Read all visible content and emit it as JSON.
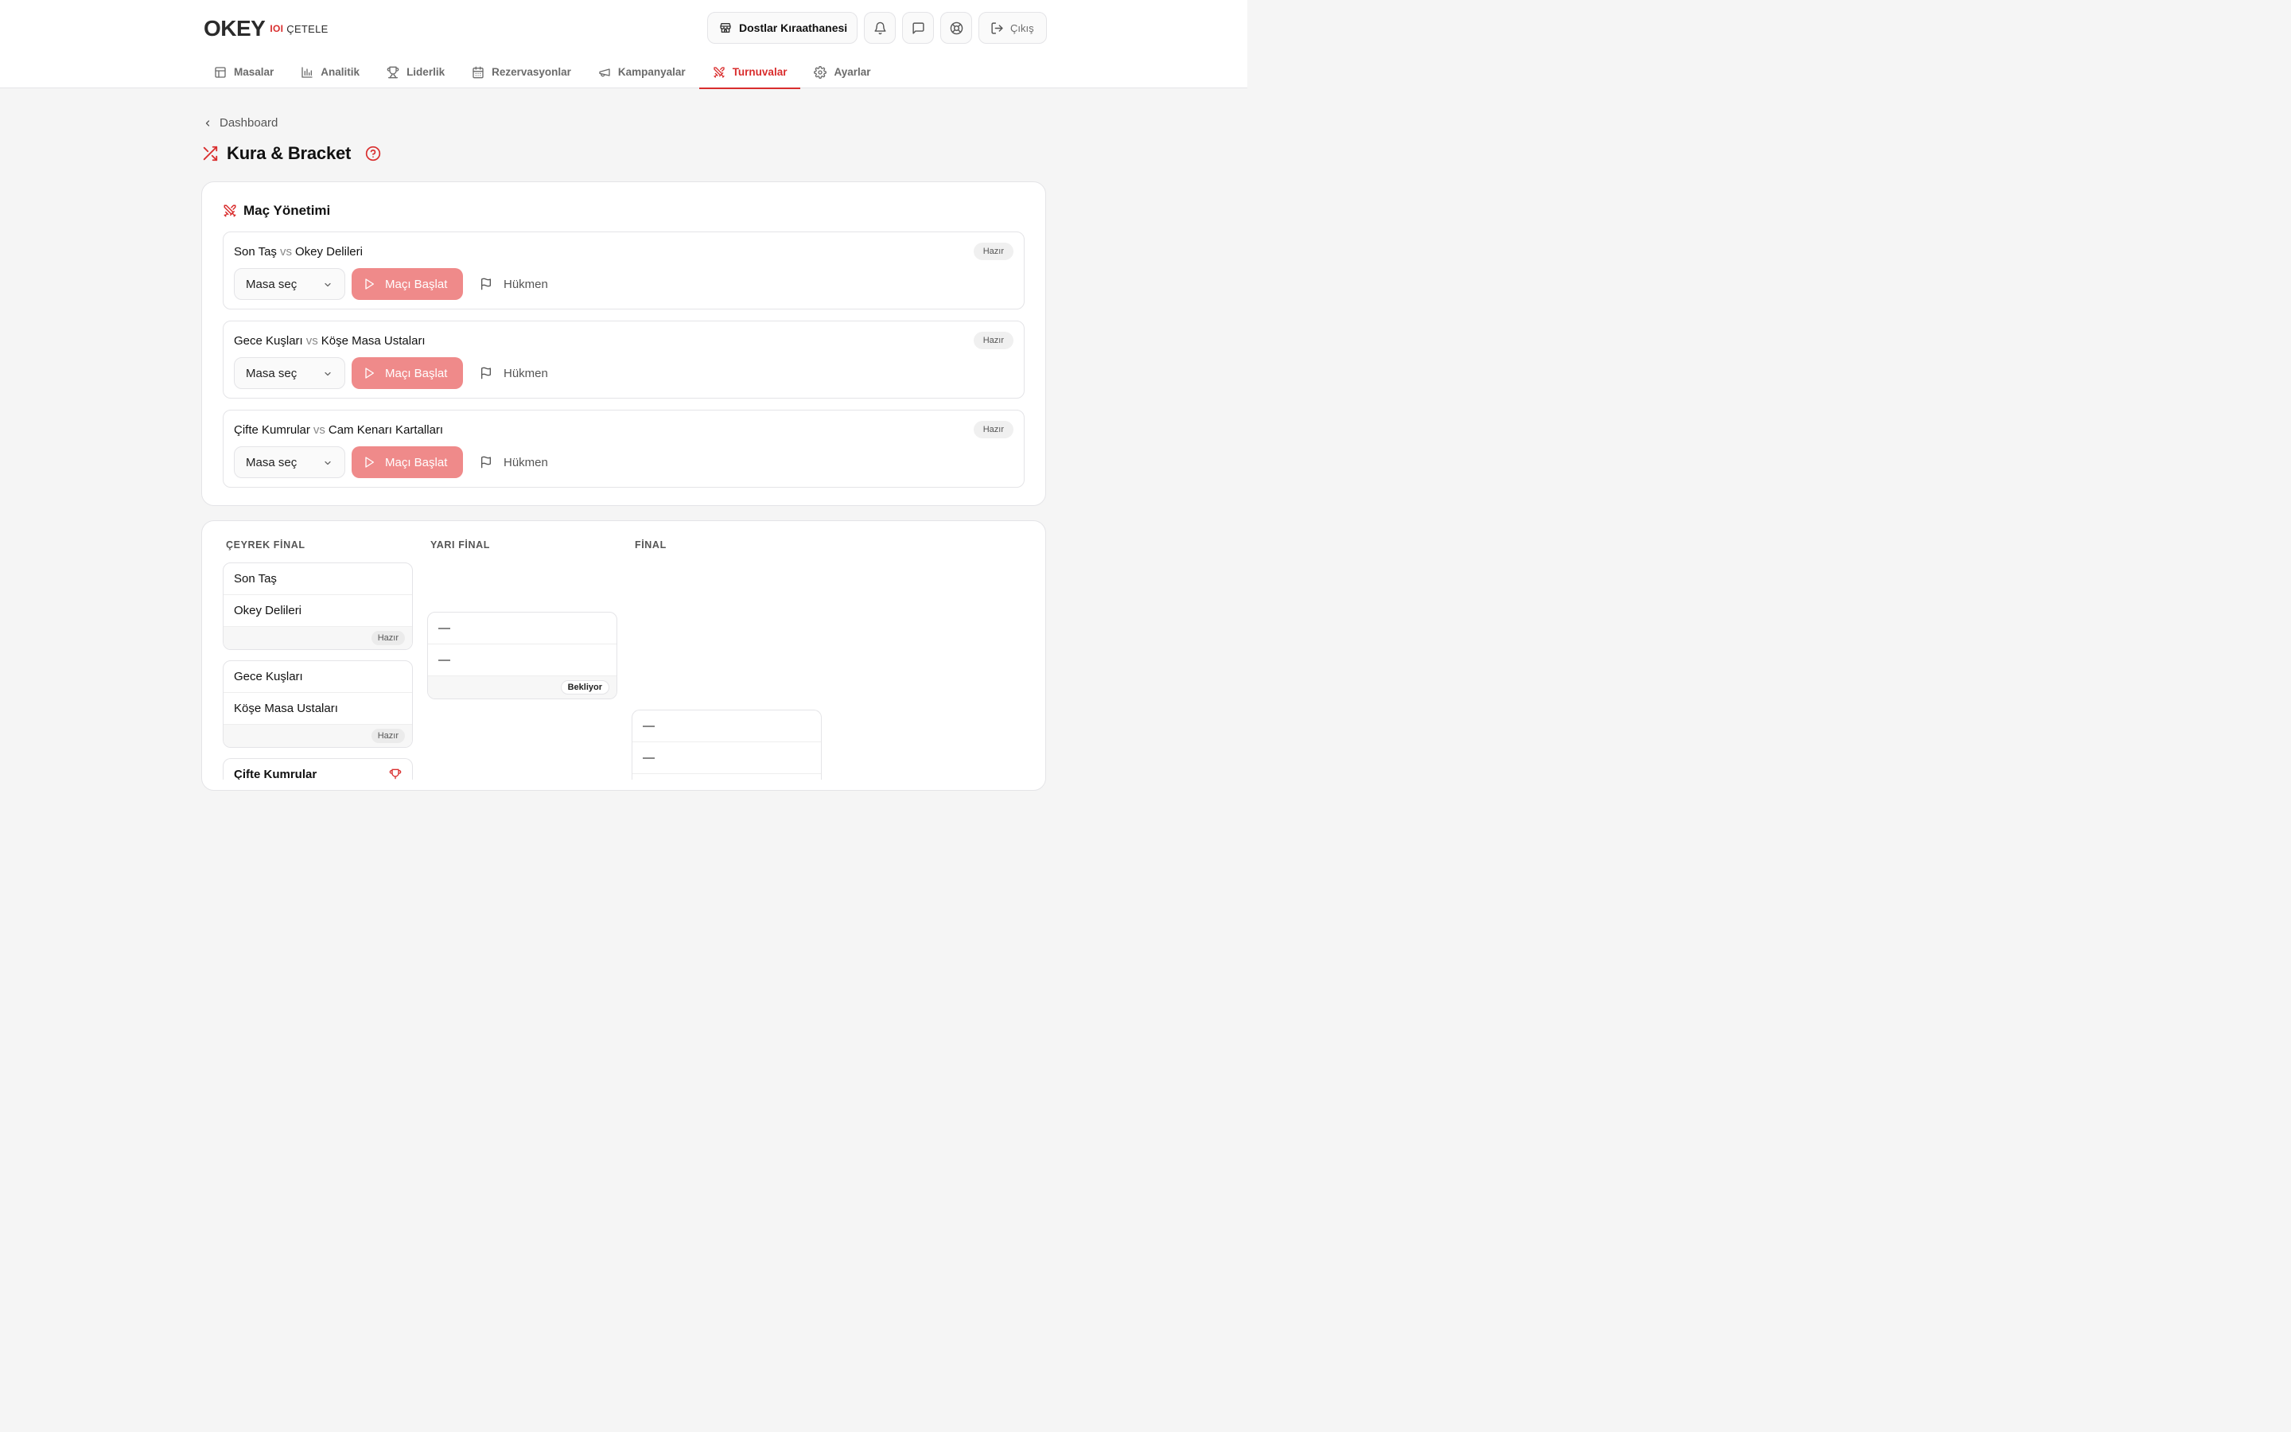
{
  "brand": {
    "logo_main": "OKEY",
    "logo_ioi": "IOI",
    "logo_sub": "ÇETELE",
    "accent": "#d92d2d"
  },
  "header": {
    "venue": "Dostlar Kıraathanesi",
    "logout": "Çıkış"
  },
  "nav": {
    "items": [
      {
        "label": "Masalar",
        "icon": "table-icon"
      },
      {
        "label": "Analitik",
        "icon": "bar-chart-icon"
      },
      {
        "label": "Liderlik",
        "icon": "trophy-icon"
      },
      {
        "label": "Rezervasyonlar",
        "icon": "calendar-icon"
      },
      {
        "label": "Kampanyalar",
        "icon": "megaphone-icon"
      },
      {
        "label": "Turnuvalar",
        "icon": "swords-icon",
        "active": true
      },
      {
        "label": "Ayarlar",
        "icon": "gear-icon"
      }
    ]
  },
  "breadcrumb": "Dashboard",
  "page_title": "Kura & Bracket",
  "match_management": {
    "title": "Maç Yönetimi",
    "vs_label": "vs",
    "select_placeholder": "Masa seç",
    "start_label": "Maçı Başlat",
    "walkover_label": "Hükmen",
    "matches": [
      {
        "home": "Son Taş",
        "away": "Okey Delileri",
        "status": "Hazır"
      },
      {
        "home": "Gece Kuşları",
        "away": "Köşe Masa Ustaları",
        "status": "Hazır"
      },
      {
        "home": "Çifte Kumrular",
        "away": "Cam Kenarı Kartalları",
        "status": "Hazır"
      }
    ]
  },
  "bracket": {
    "rounds": [
      "ÇEYREK FİNAL",
      "YARI FİNAL",
      "FİNAL"
    ],
    "quarterfinals": [
      {
        "team1": "Son Taş",
        "team2": "Okey Delileri",
        "status": "Hazır"
      },
      {
        "team1": "Gece Kuşları",
        "team2": "Köşe Masa Ustaları",
        "status": "Hazır"
      },
      {
        "team1": "Çifte Kumrular"
      }
    ],
    "semifinals": [
      {
        "team1": "—",
        "team2": "—",
        "status": "Bekliyor"
      }
    ],
    "final": [
      {
        "team1": "—",
        "team2": "—"
      }
    ]
  }
}
